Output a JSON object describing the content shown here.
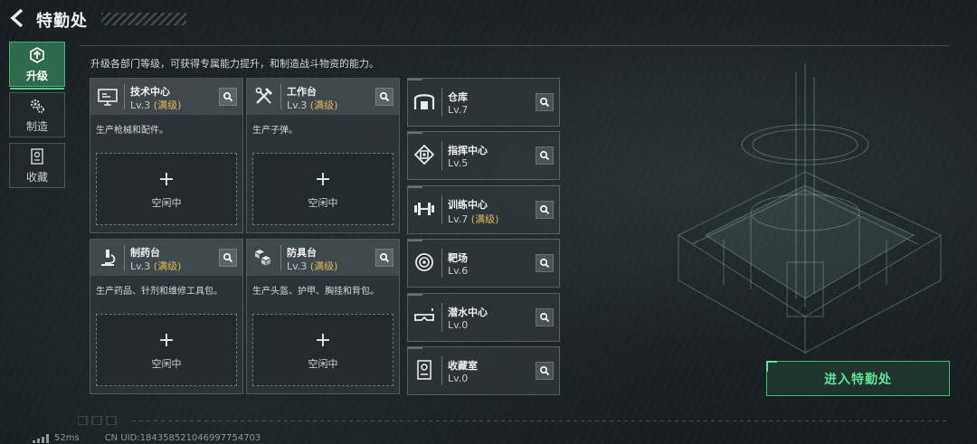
{
  "header": {
    "title": "特勤处",
    "back_icon": "back-arrow-icon"
  },
  "nav": [
    {
      "label": "升级",
      "icon": "upgrade-icon",
      "active": true
    },
    {
      "label": "制造",
      "icon": "gears-icon",
      "active": false
    },
    {
      "label": "收藏",
      "icon": "collection-icon",
      "active": false
    }
  ],
  "description": "升级各部门等级，可获得专属能力提升，和制造战斗物资的能力。",
  "big_cards": [
    {
      "name": "技术中心",
      "level": "Lv.3",
      "max": "(满级)",
      "desc": "生产枪械和配件。",
      "slot_label": "空闲中",
      "icon": "computer-icon"
    },
    {
      "name": "工作台",
      "level": "Lv.3",
      "max": "(满级)",
      "desc": "生产子弹。",
      "slot_label": "空闲中",
      "icon": "tools-icon"
    },
    {
      "name": "制药台",
      "level": "Lv.3",
      "max": "(满级)",
      "desc": "生产药品、针剂和维修工具包。",
      "slot_label": "空闲中",
      "icon": "microscope-icon"
    },
    {
      "name": "防具台",
      "level": "Lv.3",
      "max": "(满级)",
      "desc": "生产头盔、护甲、胸挂和背包。",
      "slot_label": "空闲中",
      "icon": "cubes-icon"
    }
  ],
  "small_cards": [
    {
      "name": "仓库",
      "level": "Lv.7",
      "max": "",
      "icon": "warehouse-icon"
    },
    {
      "name": "指挥中心",
      "level": "Lv.5",
      "max": "",
      "icon": "chip-icon"
    },
    {
      "name": "训练中心",
      "level": "Lv.7",
      "max": "(满级)",
      "icon": "dumbbell-icon"
    },
    {
      "name": "靶场",
      "level": "Lv.6",
      "max": "",
      "icon": "target-icon"
    },
    {
      "name": "潜水中心",
      "level": "Lv.0",
      "max": "",
      "icon": "diving-mask-icon"
    },
    {
      "name": "收藏室",
      "level": "Lv.0",
      "max": "",
      "icon": "trophy-icon"
    }
  ],
  "slot_plus": "+",
  "enter_button": "进入特勤处",
  "status": {
    "ping": "52ms",
    "uid": "CN UID:18435852104699775​4703"
  },
  "colors": {
    "accent_green": "#5fe39a",
    "max_gold": "#e0b85a",
    "active_tab": "#2f6a4c"
  }
}
